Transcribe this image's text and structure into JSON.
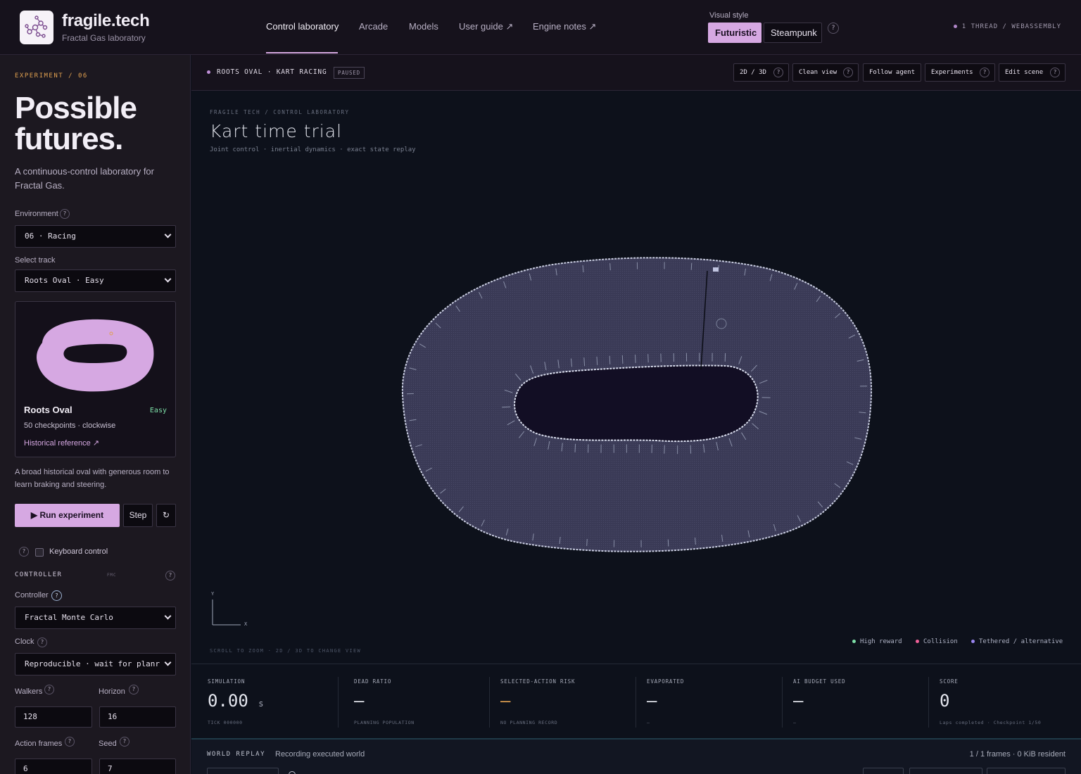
{
  "brand": {
    "name": "fragile.tech",
    "subtitle": "Fractal Gas laboratory"
  },
  "nav": [
    {
      "label": "Control laboratory",
      "active": true
    },
    {
      "label": "Arcade"
    },
    {
      "label": "Models"
    },
    {
      "label": "User guide ↗"
    },
    {
      "label": "Engine notes ↗"
    }
  ],
  "visual_style": {
    "label": "Visual style",
    "options": [
      "Futuristic",
      "Steampunk"
    ],
    "selected": "Futuristic",
    "help": "?"
  },
  "runtime": "1 THREAD / WEBASSEMBLY",
  "sidebar": {
    "experiment_label": "EXPERIMENT / 06",
    "hero_line1": "Possible",
    "hero_line2": "futures.",
    "hero_sub": "A continuous-control laboratory for Fractal Gas.",
    "environment_label": "Environment",
    "environment_value": "06 · Racing",
    "track_label": "Select track",
    "track_value": "Roots Oval · Easy",
    "track_card": {
      "name": "Roots Oval",
      "difficulty": "Easy",
      "meta": "50 checkpoints · clockwise",
      "link": "Historical reference ↗"
    },
    "description": "A broad historical oval with generous room to learn braking and steering.",
    "run_label": "▶ Run experiment",
    "step_label": "Step",
    "reset_icon": "↻",
    "keyboard_label": "Keyboard control",
    "keyboard_checked": false,
    "controller_section": "CONTROLLER",
    "controller_tag": "FMC",
    "controller_label": "Controller",
    "controller_value": "Fractal Monte Carlo",
    "clock_label": "Clock",
    "clock_value": "Reproducible · wait for planr",
    "walkers_label": "Walkers",
    "walkers_value": "128",
    "horizon_label": "Horizon",
    "horizon_value": "16",
    "action_frames_label": "Action frames",
    "action_frames_value": "6",
    "seed_label": "Seed",
    "seed_value": "7",
    "help": "?"
  },
  "run_header": {
    "title": "ROOTS OVAL · KART RACING",
    "status": "PAUSED",
    "buttons": [
      {
        "label": "2D / 3D",
        "help": "?"
      },
      {
        "label": "Clean view",
        "help": "?"
      },
      {
        "label": "Follow agent"
      },
      {
        "label": "Experiments",
        "help": "?"
      },
      {
        "label": "Edit scene",
        "help": "?"
      }
    ]
  },
  "stage": {
    "crumb": "FRAGILE TECH / CONTROL LABORATORY",
    "title": "Kart time trial",
    "subtitle": "Joint control · inertial dynamics · exact state replay",
    "axis_y": "Y",
    "axis_x": "X",
    "hint": "SCROLL TO ZOOM · 2D / 3D TO CHANGE VIEW",
    "legend": [
      {
        "label": "High reward",
        "color": "#7ee0a8"
      },
      {
        "label": "Collision",
        "color": "#f06098"
      },
      {
        "label": "Tethered / alternative",
        "color": "#9a86f0"
      }
    ]
  },
  "metrics": [
    {
      "label": "SIMULATION",
      "value": "0.00",
      "unit": "s",
      "foot": "TICK 000000"
    },
    {
      "label": "DEAD RATIO",
      "value": "—",
      "foot": "PLANNING POPULATION"
    },
    {
      "label": "SELECTED-ACTION RISK",
      "value": "—",
      "foot": "NO PLANNING RECORD",
      "accent": "#e0a050"
    },
    {
      "label": "EVAPORATED",
      "value": "—",
      "foot": "—"
    },
    {
      "label": "AI BUDGET USED",
      "value": "—",
      "foot": "—"
    },
    {
      "label": "SCORE",
      "value": "0",
      "foot": "Laps completed · Checkpoint 1/50"
    }
  ],
  "replay": {
    "label": "WORLD REPLAY",
    "status": "Recording executed world",
    "frames": "1 / 1 frames · 0 KiB resident"
  },
  "colors": {
    "accent": "#d6a8e2",
    "warning": "#e0a050"
  }
}
